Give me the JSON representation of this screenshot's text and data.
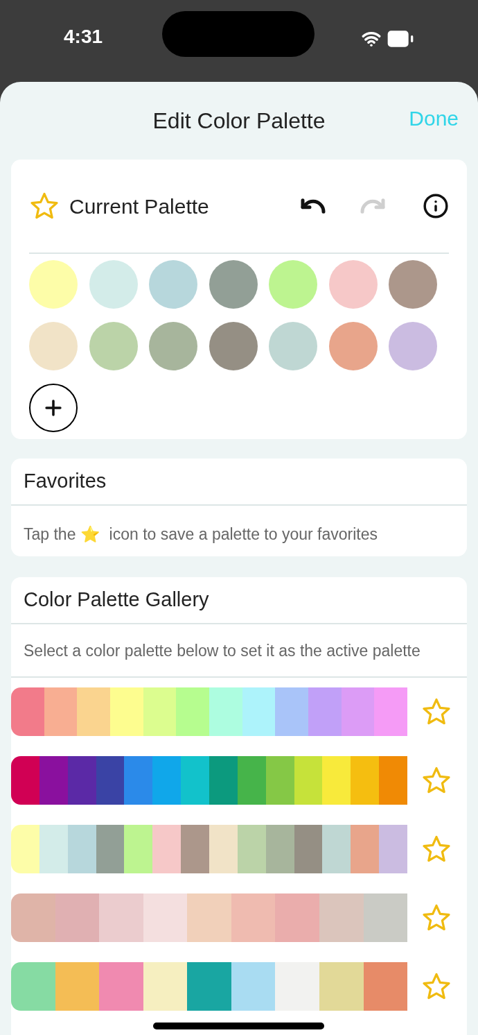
{
  "status_bar": {
    "time": "4:31"
  },
  "header": {
    "title": "Edit Color Palette",
    "done": "Done"
  },
  "current_palette": {
    "title": "Current Palette",
    "favorite": false,
    "undo": {
      "disabled": false
    },
    "redo": {
      "disabled": true
    },
    "swatches": [
      {
        "color": "#fdfda8"
      },
      {
        "color": "#d3ece9"
      },
      {
        "color": "#b7d7dc"
      },
      {
        "color": "#929f96"
      },
      {
        "color": "#bdf490"
      },
      {
        "color": "#f6c8c8"
      },
      {
        "color": "#ac978b"
      },
      {
        "color": "#f1e3c7"
      },
      {
        "color": "#bbd3a8"
      },
      {
        "color": "#a7b59c"
      },
      {
        "color": "#958f84"
      },
      {
        "color": "#bfd7d3"
      },
      {
        "color": "#e8a58b"
      },
      {
        "color": "#cbbce1"
      }
    ]
  },
  "favorites": {
    "title": "Favorites",
    "hint": "Tap the ⭐  icon to save a palette to your favorites"
  },
  "gallery": {
    "title": "Color Palette Gallery",
    "description": "Select a color palette below to set it as the active palette",
    "palettes": [
      {
        "favorite": false,
        "swatches": [
          {
            "color": "#f27b8a"
          },
          {
            "color": "#f8ae92"
          },
          {
            "color": "#fad48f"
          },
          {
            "color": "#fdfd8f"
          },
          {
            "color": "#dcfd8f"
          },
          {
            "color": "#b6fd8f"
          },
          {
            "color": "#adfde0"
          },
          {
            "color": "#adf3fb"
          },
          {
            "color": "#a9c4f9"
          },
          {
            "color": "#c1a0f8"
          },
          {
            "color": "#dc9cf6"
          },
          {
            "color": "#f59bf6"
          }
        ]
      },
      {
        "favorite": false,
        "swatches": [
          {
            "color": "#d10054"
          },
          {
            "color": "#8a109e"
          },
          {
            "color": "#5b29a6"
          },
          {
            "color": "#3a43a5"
          },
          {
            "color": "#2b8ae9"
          },
          {
            "color": "#10a7ea"
          },
          {
            "color": "#12c2cb"
          },
          {
            "color": "#0c9a7e"
          },
          {
            "color": "#46b44a"
          },
          {
            "color": "#85c846"
          },
          {
            "color": "#c6e23a"
          },
          {
            "color": "#f8ea3b"
          },
          {
            "color": "#f5be10"
          },
          {
            "color": "#f08a05"
          }
        ]
      },
      {
        "favorite": false,
        "swatches": [
          {
            "color": "#fdfda8"
          },
          {
            "color": "#d3ece9"
          },
          {
            "color": "#b7d7dc"
          },
          {
            "color": "#929f96"
          },
          {
            "color": "#bdf490"
          },
          {
            "color": "#f6c8c8"
          },
          {
            "color": "#ac978b"
          },
          {
            "color": "#f1e3c7"
          },
          {
            "color": "#bbd3a8"
          },
          {
            "color": "#a7b59c"
          },
          {
            "color": "#958f84"
          },
          {
            "color": "#bfd7d3"
          },
          {
            "color": "#e8a58b"
          },
          {
            "color": "#cbbce1"
          }
        ]
      },
      {
        "favorite": false,
        "swatches": [
          {
            "color": "#dfb4a8"
          },
          {
            "color": "#e0b0b2"
          },
          {
            "color": "#ebccce"
          },
          {
            "color": "#f4dfdf"
          },
          {
            "color": "#f1d0ba"
          },
          {
            "color": "#efbbb0"
          },
          {
            "color": "#eaadac"
          },
          {
            "color": "#dbc5bc"
          },
          {
            "color": "#cacbc5"
          }
        ]
      },
      {
        "favorite": false,
        "swatches": [
          {
            "color": "#86dba3"
          },
          {
            "color": "#f4bd55"
          },
          {
            "color": "#f08ab0"
          },
          {
            "color": "#f6efc0"
          },
          {
            "color": "#19a6a2"
          },
          {
            "color": "#a9dcf2"
          },
          {
            "color": "#f2f2f0"
          },
          {
            "color": "#e2d998"
          },
          {
            "color": "#e78b68"
          }
        ]
      }
    ]
  }
}
